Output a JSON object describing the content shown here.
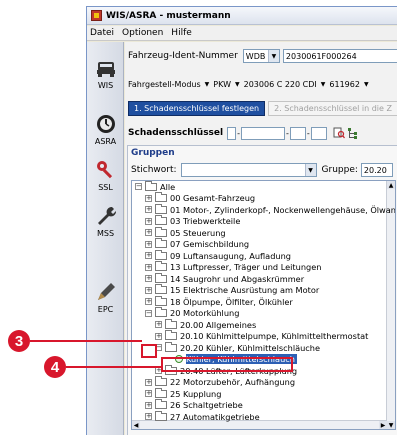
{
  "window": {
    "title": "WIS/ASRA - mustermann"
  },
  "menu": [
    "Datei",
    "Optionen",
    "Hilfe"
  ],
  "sidebar": [
    {
      "label": "WIS",
      "icon": "car-icon"
    },
    {
      "label": "ASRA",
      "icon": "stopwatch-icon"
    },
    {
      "label": "SSL",
      "icon": "key-icon"
    },
    {
      "label": "MSS",
      "icon": "wrench-icon"
    },
    {
      "label": "EPC",
      "icon": "pen-icon"
    }
  ],
  "ident": {
    "label": "Fahrzeug-Ident-Nummer",
    "prefix": "WDB",
    "value": "2030061F000264"
  },
  "fahrgestell": {
    "mode": "Fahrgestell-Modus",
    "type": "PKW",
    "model": "203006 C 220 CDI",
    "code": "611962"
  },
  "steps": {
    "step1": "1. Schadensschlüssel festlegen",
    "step2": "2. Schadensschlüssel in die Z"
  },
  "schadensschluessel_label": "Schadensschlüssel",
  "groups": {
    "heading": "Gruppen",
    "stichwort_label": "Stichwort:",
    "gruppe_label": "Gruppe:",
    "gruppe_value": "20.20"
  },
  "tree": [
    {
      "text": "Alle",
      "level": 0,
      "exp": "−"
    },
    {
      "text": "00 Gesamt-Fahrzeug",
      "level": 1,
      "exp": "+"
    },
    {
      "text": "01 Motor-, Zylinderkopf-, Nockenwellengehäuse, Ölwanne",
      "level": 1,
      "exp": "+"
    },
    {
      "text": "03 Triebwerkteile",
      "level": 1,
      "exp": "+"
    },
    {
      "text": "05 Steuerung",
      "level": 1,
      "exp": "+"
    },
    {
      "text": "07 Gemischbildung",
      "level": 1,
      "exp": "+"
    },
    {
      "text": "09 Luftansaugung, Aufladung",
      "level": 1,
      "exp": "+"
    },
    {
      "text": "13 Luftpresser, Träger und Leitungen",
      "level": 1,
      "exp": "+"
    },
    {
      "text": "14 Saugrohr und Abgaskrümmer",
      "level": 1,
      "exp": "+"
    },
    {
      "text": "15 Elektrische Ausrüstung am Motor",
      "level": 1,
      "exp": "+"
    },
    {
      "text": "18 Ölpumpe, Ölfilter, Ölkühler",
      "level": 1,
      "exp": "+"
    },
    {
      "text": "20 Motorkühlung",
      "level": 1,
      "exp": "−"
    },
    {
      "text": "20.00 Allgemeines",
      "level": 2,
      "exp": "+"
    },
    {
      "text": "20.10 Kühlmittelpumpe, Kühlmittelthermostat",
      "level": 2,
      "exp": "+"
    },
    {
      "text": "20.20 Kühler, Kühlmittelschläuche",
      "level": 2,
      "exp": "−"
    },
    {
      "text": "Kühler, Kühlmittelschlauch",
      "level": 3,
      "exp": "",
      "leaf": true,
      "selected": true
    },
    {
      "text": "20.40 Lüfter, Lüfterkupplung",
      "level": 2,
      "exp": "+"
    },
    {
      "text": "22 Motorzubehör, Aufhängung",
      "level": 1,
      "exp": "+"
    },
    {
      "text": "25 Kupplung",
      "level": 1,
      "exp": "+"
    },
    {
      "text": "26 Schaltgetriebe",
      "level": 1,
      "exp": "+"
    },
    {
      "text": "27 Automatikgetriebe",
      "level": 1,
      "exp": "+"
    }
  ],
  "callouts": {
    "a": "3",
    "b": "4"
  },
  "colors": {
    "accent": "#1f4fa0",
    "callout": "#d8172c",
    "selection": "#2c5fb4"
  }
}
